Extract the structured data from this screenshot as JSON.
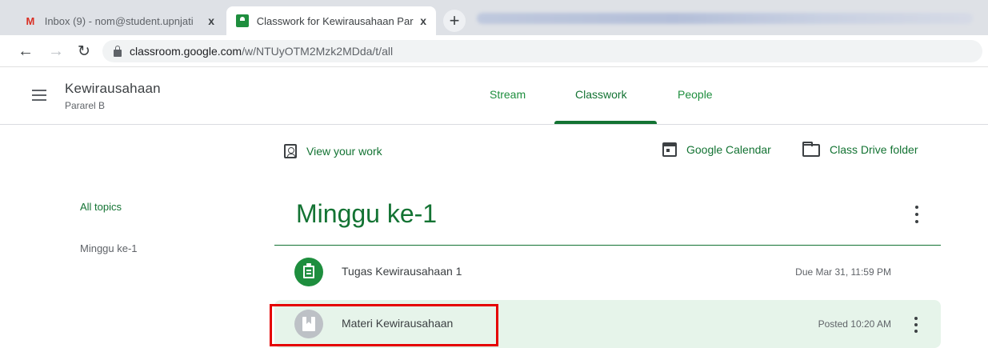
{
  "browser": {
    "tabs": [
      {
        "title": "Inbox (9) - nom@student.upnjati",
        "icon": "gmail-icon",
        "active": false
      },
      {
        "title": "Classwork for Kewirausahaan Par",
        "icon": "classroom-icon",
        "active": true
      }
    ],
    "new_tab_symbol": "+",
    "close_symbol": "x",
    "url_host": "classroom.google.com",
    "url_path": "/w/NTUyOTM2Mzk2MDda/t/all"
  },
  "classroom": {
    "class_name": "Kewirausahaan",
    "section": "Pararel B",
    "nav": {
      "stream": "Stream",
      "classwork": "Classwork",
      "people": "People"
    },
    "actions": {
      "view_work": "View your work",
      "calendar": "Google Calendar",
      "drive": "Class Drive folder"
    },
    "topics": [
      "All topics",
      "Minggu ke-1"
    ],
    "section_title": "Minggu ke-1",
    "items": [
      {
        "type": "assignment",
        "title": "Tugas Kewirausahaan 1",
        "date": "Due Mar 31, 11:59 PM",
        "icon": "assignment-icon"
      },
      {
        "type": "material",
        "title": "Materi Kewirausahaan",
        "date": "Posted 10:20 AM",
        "icon": "material-icon"
      }
    ]
  },
  "colors": {
    "accent": "#137333",
    "highlight_row": "#e6f4ea",
    "annotation": "#e50000"
  }
}
